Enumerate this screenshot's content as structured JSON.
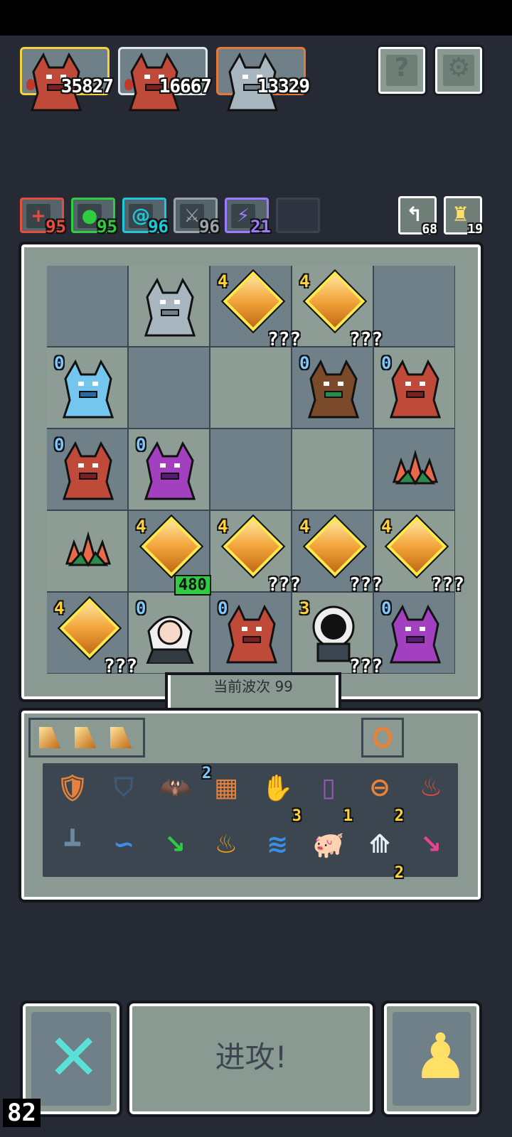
{
  "scores": [
    {
      "value": "35827",
      "border": "#f5d13c"
    },
    {
      "value": "16667",
      "border": "#dfe6e9"
    },
    {
      "value": "13329",
      "border": "#e6783a"
    }
  ],
  "top_buttons": {
    "help_glyph": "?",
    "settings_glyph": "⚙"
  },
  "stats": [
    {
      "value": "95",
      "color": "#e74c3c",
      "icon": "+"
    },
    {
      "value": "95",
      "color": "#2ecc40",
      "icon": "●"
    },
    {
      "value": "96",
      "color": "#1ec8d8",
      "icon": "@"
    },
    {
      "value": "96",
      "color": "#9aa3a8",
      "icon": "⚔"
    },
    {
      "value": "21",
      "color": "#9b7bff",
      "icon": "⚡"
    }
  ],
  "resources": [
    {
      "value": "68",
      "icon": "↰"
    },
    {
      "value": "19",
      "icon": "♜"
    }
  ],
  "grid": [
    [
      {
        "type": "empty",
        "shade": "dark"
      },
      {
        "type": "monster",
        "kind": "stone-golem",
        "shade": "light"
      },
      {
        "type": "gem",
        "level": "4",
        "label": "???",
        "shade": "dark"
      },
      {
        "type": "gem",
        "level": "4",
        "label": "???",
        "shade": "light"
      },
      {
        "type": "empty",
        "shade": "dark"
      }
    ],
    [
      {
        "type": "monster",
        "kind": "ice-demon",
        "level": "0",
        "shade": "light"
      },
      {
        "type": "empty",
        "shade": "dark"
      },
      {
        "type": "empty",
        "shade": "light"
      },
      {
        "type": "monster",
        "kind": "minotaur",
        "level": "0",
        "shade": "dark"
      },
      {
        "type": "monster",
        "kind": "red-dragon",
        "level": "0",
        "shade": "light"
      }
    ],
    [
      {
        "type": "monster",
        "kind": "red-dragon",
        "level": "0",
        "shade": "dark"
      },
      {
        "type": "monster",
        "kind": "purple-dragon",
        "level": "0",
        "shade": "light"
      },
      {
        "type": "empty",
        "shade": "dark"
      },
      {
        "type": "empty",
        "shade": "light"
      },
      {
        "type": "monster",
        "kind": "crystal-plant",
        "shade": "dark"
      }
    ],
    [
      {
        "type": "monster",
        "kind": "crystal-plant",
        "shade": "light"
      },
      {
        "type": "gem",
        "level": "4",
        "gain": "480",
        "shade": "dark"
      },
      {
        "type": "gem",
        "level": "4",
        "label": "???",
        "shade": "light"
      },
      {
        "type": "gem",
        "level": "4",
        "label": "???",
        "shade": "dark"
      },
      {
        "type": "gem",
        "level": "4",
        "label": "???",
        "shade": "light"
      }
    ],
    [
      {
        "type": "gem",
        "level": "4",
        "label": "???",
        "shade": "dark"
      },
      {
        "type": "monster",
        "kind": "white-haired-mage",
        "level": "0",
        "shade": "light"
      },
      {
        "type": "monster",
        "kind": "red-dragon",
        "level": "0",
        "shade": "dark"
      },
      {
        "type": "monster",
        "kind": "dark-portal",
        "level": "3",
        "label": "???",
        "shade": "light"
      },
      {
        "type": "monster",
        "kind": "purple-dragon",
        "level": "0",
        "shade": "dark"
      }
    ]
  ],
  "wave_label": "当前波次 99",
  "inventory": {
    "row1": [
      {
        "icon": "armor-icon",
        "glyph": "🛡",
        "color": "#e8813a"
      },
      {
        "icon": "shield-icon",
        "glyph": "⛉",
        "color": "#3e5a7a"
      },
      {
        "icon": "bat-icon",
        "glyph": "🦇",
        "color": "#c0392b"
      },
      {
        "icon": "fire-scroll-icon",
        "glyph": "▦",
        "color": "#e8813a",
        "top_count": "2"
      },
      {
        "icon": "claw-icon",
        "glyph": "✋",
        "color": "#2ecc40",
        "count": "3"
      },
      {
        "icon": "jar-icon",
        "glyph": "▯",
        "color": "#9b59b6",
        "count": "1"
      },
      {
        "icon": "ring-icon",
        "glyph": "⊖",
        "color": "#e8813a",
        "count": "2"
      },
      {
        "icon": "fire-tile-icon",
        "glyph": "♨",
        "color": "#e74c3c"
      }
    ],
    "row2": [
      {
        "icon": "joystick-icon",
        "glyph": "┻",
        "color": "#6a8aa0"
      },
      {
        "icon": "wave-icon",
        "glyph": "∽",
        "color": "#3a8ee6"
      },
      {
        "icon": "arrow-icon",
        "glyph": "↘",
        "color": "#2ecc40"
      },
      {
        "icon": "flame-tile-icon",
        "glyph": "♨",
        "color": "#f39c12"
      },
      {
        "icon": "wind-icon",
        "glyph": "≋",
        "color": "#3a8ee6"
      },
      {
        "icon": "pig-icon",
        "glyph": "🐖",
        "color": "#f5a3b5"
      },
      {
        "icon": "wing-icon",
        "glyph": "⟰",
        "color": "#e6f0f5",
        "count": "2"
      },
      {
        "icon": "pink-arrow-icon",
        "glyph": "↘",
        "color": "#e84393"
      }
    ]
  },
  "bottom": {
    "attack_label": "进攻!",
    "corner_number": "82"
  }
}
